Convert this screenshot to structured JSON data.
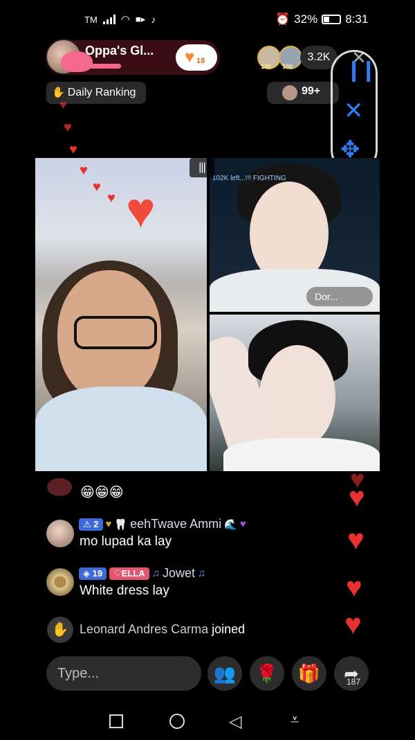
{
  "status_bar": {
    "carrier": "TM",
    "battery": "32%",
    "time": "8:31",
    "icons": [
      "signal-icon",
      "wifi-icon",
      "video-icon",
      "tiktok-icon",
      "alarm-icon",
      "battery-icon"
    ]
  },
  "host": {
    "name": "Oppa's Gl...",
    "follow_count": "18"
  },
  "viewers": {
    "top_badges": [
      "100",
      "100"
    ],
    "count": "3.2K"
  },
  "daily_ranking": {
    "label": "Daily Ranking"
  },
  "rank_right": {
    "count": "99+"
  },
  "video": {
    "top_right_banner": "102K left...!!! FIGHTING",
    "top_right_tag": "Dor..."
  },
  "chat": {
    "emoji_message": "😁😁😁",
    "messages": [
      {
        "level": "2",
        "username": "eehTwave Ammi",
        "text": "mo lupad ka lay"
      },
      {
        "level": "19",
        "tag": "ELLA",
        "username": "Jowet",
        "text": "White dress lay"
      }
    ],
    "join": {
      "name": "Leonard Andres Carma",
      "suffix": "joined"
    }
  },
  "input": {
    "placeholder": "Type..."
  },
  "actions": {
    "share_count": "187"
  },
  "colors": {
    "heart": "#e9322f",
    "accent_blue": "#2e7cf0",
    "badge_blue": "#3d6ad6",
    "badge_pink": "#e2556d"
  }
}
